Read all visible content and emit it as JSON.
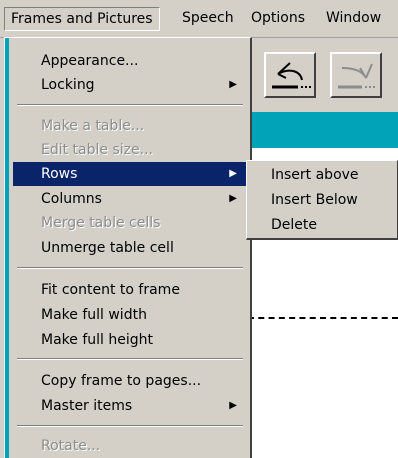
{
  "menubar": {
    "items": [
      {
        "label": "Frames and Pictures"
      },
      {
        "label": "Speech"
      },
      {
        "label": "Options"
      },
      {
        "label": "Window"
      }
    ]
  },
  "menu": {
    "items": [
      {
        "label": "Appearance..."
      },
      {
        "label": "Locking"
      },
      {
        "label": "Make a table..."
      },
      {
        "label": "Edit table size..."
      },
      {
        "label": "Rows"
      },
      {
        "label": "Columns"
      },
      {
        "label": "Merge table cells"
      },
      {
        "label": "Unmerge table cell"
      },
      {
        "label": "Fit content to frame"
      },
      {
        "label": "Make full width"
      },
      {
        "label": "Make full height"
      },
      {
        "label": "Copy frame to pages..."
      },
      {
        "label": "Master items"
      },
      {
        "label": "Rotate..."
      }
    ],
    "arrow": "▶"
  },
  "submenu": {
    "items": [
      {
        "label": "Insert above"
      },
      {
        "label": "Insert Below"
      },
      {
        "label": "Delete"
      }
    ]
  },
  "colors": {
    "highlight": "#0a246a",
    "accent": "#00a3b8",
    "face": "#d4d0c8"
  }
}
